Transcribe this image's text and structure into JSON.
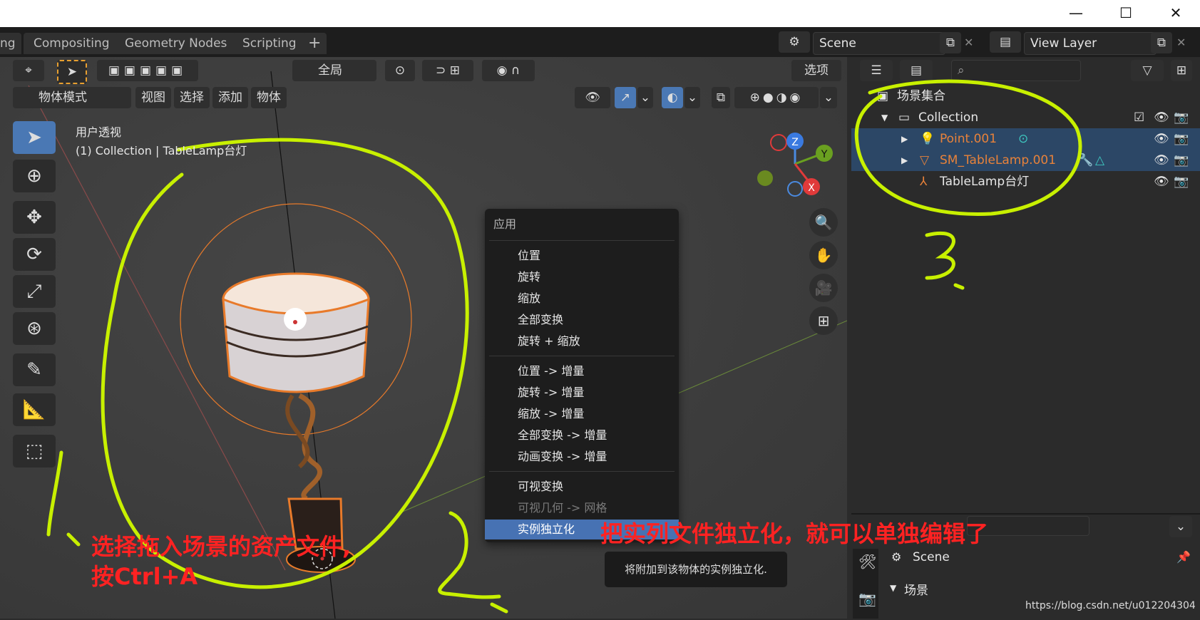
{
  "window": {
    "minimize": "—",
    "maximize": "☐",
    "close": "✕"
  },
  "tabs": [
    "ng",
    "Compositing",
    "Geometry Nodes",
    "Scripting",
    "+"
  ],
  "top_right": {
    "scene": "Scene",
    "view_layer": "View Layer"
  },
  "viewport_header": {
    "transform_orientation": "全局",
    "options": "选项",
    "mode": "物体模式",
    "menus": [
      "视图",
      "选择",
      "添加",
      "物体"
    ]
  },
  "viewport": {
    "view_name": "用户透视",
    "object_info": "(1) Collection | TableLamp台灯",
    "gizmo": {
      "z": "Z",
      "y": "Y",
      "x": "X"
    }
  },
  "menu": {
    "title": "应用",
    "group1": [
      "位置",
      "旋转",
      "缩放",
      "全部变换",
      "旋转 + 缩放"
    ],
    "group2": [
      "位置 -> 增量",
      "旋转 -> 增量",
      "缩放 -> 增量",
      "全部变换 -> 增量",
      "动画变换 -> 增量"
    ],
    "group3": [
      "可视变换",
      "可视几何 -> 网格"
    ],
    "selected": "实例独立化"
  },
  "tooltip": "将附加到该物体的实例独立化.",
  "outliner": {
    "root": "场景集合",
    "collection": "Collection",
    "items": [
      "Point.001",
      "SM_TableLamp.001",
      "TableLamp台灯"
    ],
    "item_colors": [
      "#e8823a",
      "#e8823a",
      "#e6e6e6"
    ]
  },
  "properties": {
    "scene": "Scene",
    "section": "场景"
  },
  "annotations": {
    "step1_line1": "选择拖入场景的资产文件,",
    "step1_line2": "按Ctrl+A",
    "step2": "把实列文件独立化，就可以单独编辑了",
    "num1": "1、",
    "num2": "2.-",
    "num3": "3."
  },
  "watermark": "https://blog.csdn.net/u012204304"
}
